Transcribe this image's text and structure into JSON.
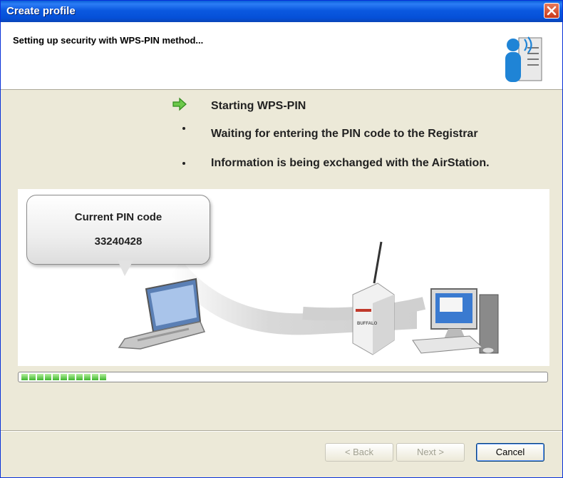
{
  "window": {
    "title": "Create profile"
  },
  "header": {
    "text": "Setting up security with WPS-PIN method..."
  },
  "steps": [
    {
      "text": "Starting WPS-PIN",
      "state": "current"
    },
    {
      "text": "Waiting for entering the PIN code to the Registrar",
      "state": "pending"
    },
    {
      "text": "Information is being exchanged with the AirStation.",
      "state": "pending"
    }
  ],
  "pin": {
    "label": "Current PIN code",
    "value": "33240428"
  },
  "progress": {
    "blocks_filled": 11
  },
  "buttons": {
    "back": "< Back",
    "next": "Next >",
    "cancel": "Cancel"
  },
  "icons": {
    "close": "close-icon",
    "header": "wireless-user-icon",
    "current_step": "green-arrow-icon",
    "pending_step": "bullet-icon",
    "router_brand": "BUFFALO"
  },
  "colors": {
    "titlebar": "#0b59e0",
    "accent_green": "#3fb62d",
    "close_red": "#d4451f"
  }
}
